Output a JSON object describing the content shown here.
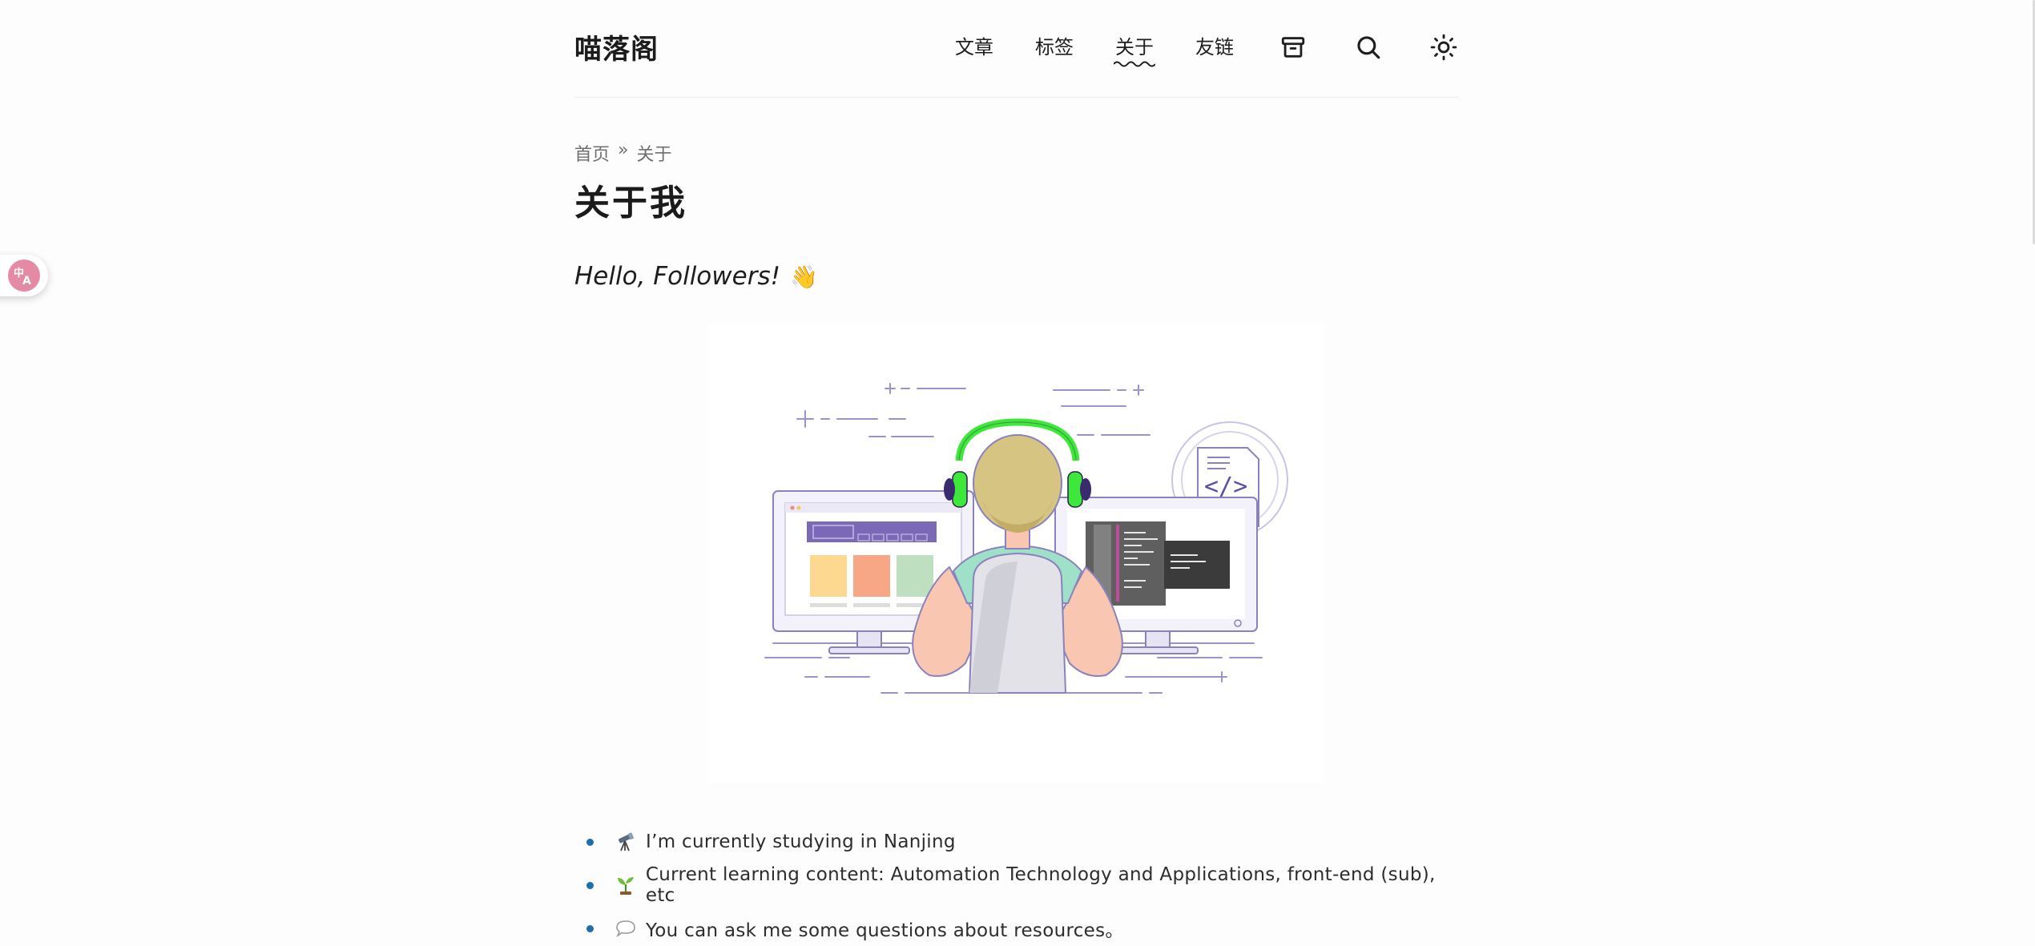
{
  "site": {
    "title": "喵落阁"
  },
  "nav": {
    "items": [
      {
        "label": "文章"
      },
      {
        "label": "标签"
      },
      {
        "label": "关于"
      },
      {
        "label": "友链"
      }
    ],
    "active": "关于",
    "icons": [
      "archive-icon",
      "search-icon",
      "theme-toggle-icon"
    ]
  },
  "breadcrumb": {
    "home": "首页",
    "separator": "»",
    "current": "关于"
  },
  "page": {
    "title": "关于我",
    "greeting": "Hello, Followers!",
    "greeting_emoji": "👋"
  },
  "about_list": [
    {
      "icon": "telescope-icon",
      "text": "I’m currently studying in Nanjing"
    },
    {
      "icon": "seedling-icon",
      "text": "Current learning content: Automation Technology and Applications, front-end (sub), etc"
    },
    {
      "icon": "speech-bubble-icon",
      "text": "You can ask me some questions about resources。"
    }
  ],
  "colors": {
    "accent": "#1e6fa8",
    "translate_badge": "#e48aa5",
    "headphones": "#3ee83a"
  }
}
